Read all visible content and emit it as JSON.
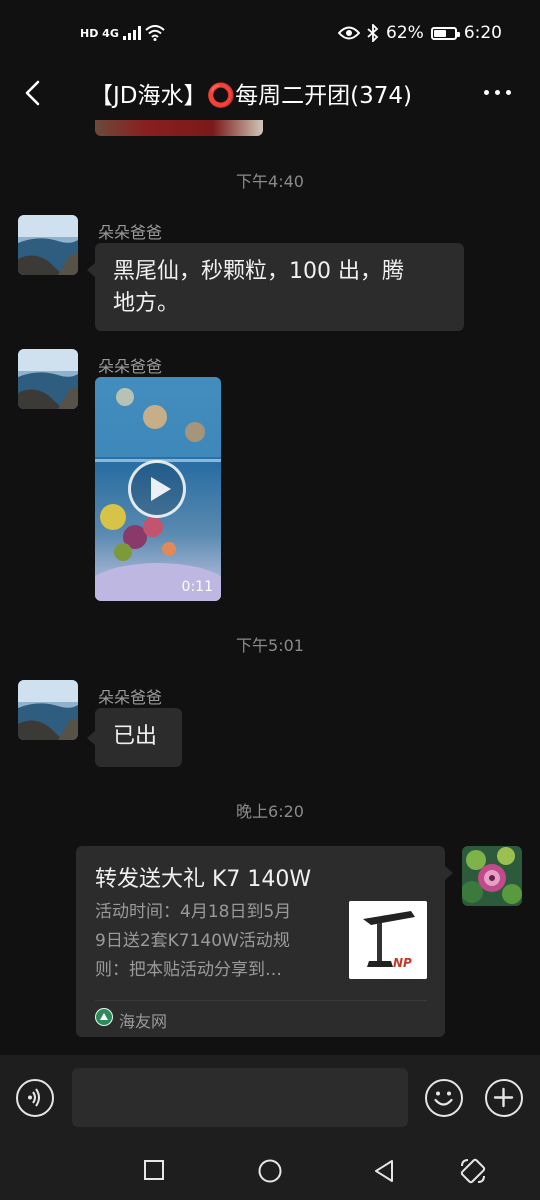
{
  "status_bar": {
    "network": "HD 4G",
    "battery": "62%",
    "battery_level": 0.62,
    "time": "6:20"
  },
  "header": {
    "title": "【JD海水】⭕每周二开团(374)",
    "back_icon": "back-arrow-icon",
    "more_icon": "more-dots-icon"
  },
  "messages": [
    {
      "type": "time",
      "text": "下午4:40"
    },
    {
      "type": "text",
      "sender": "朵朵爸爸",
      "line1": "黑尾仙，秒颗粒，100 出，腾",
      "line2": "地方。"
    },
    {
      "type": "video",
      "sender": "朵朵爸爸",
      "duration": "0:11"
    },
    {
      "type": "time",
      "text": "下午5:01"
    },
    {
      "type": "text",
      "sender": "朵朵爸爸",
      "line1": "已出"
    },
    {
      "type": "time",
      "text": "晚上6:20"
    },
    {
      "type": "link_card",
      "title": "转发送大礼 K7 140W",
      "desc_line1": "活动时间：4月18日到5月",
      "desc_line2": "9日送2套K7140W活动规",
      "desc_line3": "则：把本贴活动分享到…",
      "source": "海友网"
    }
  ],
  "input_bar": {
    "voice_icon": "voice-icon",
    "placeholder": "",
    "emoji_icon": "emoji-icon",
    "plus_icon": "plus-icon"
  },
  "nav_bar": {
    "icons": [
      "square-icon",
      "circle-icon",
      "triangle-back-icon",
      "rotate-icon"
    ]
  },
  "colors": {
    "background": "#111111",
    "bubble": "#2c2c2c",
    "secondary_text": "#9a9a9a"
  }
}
